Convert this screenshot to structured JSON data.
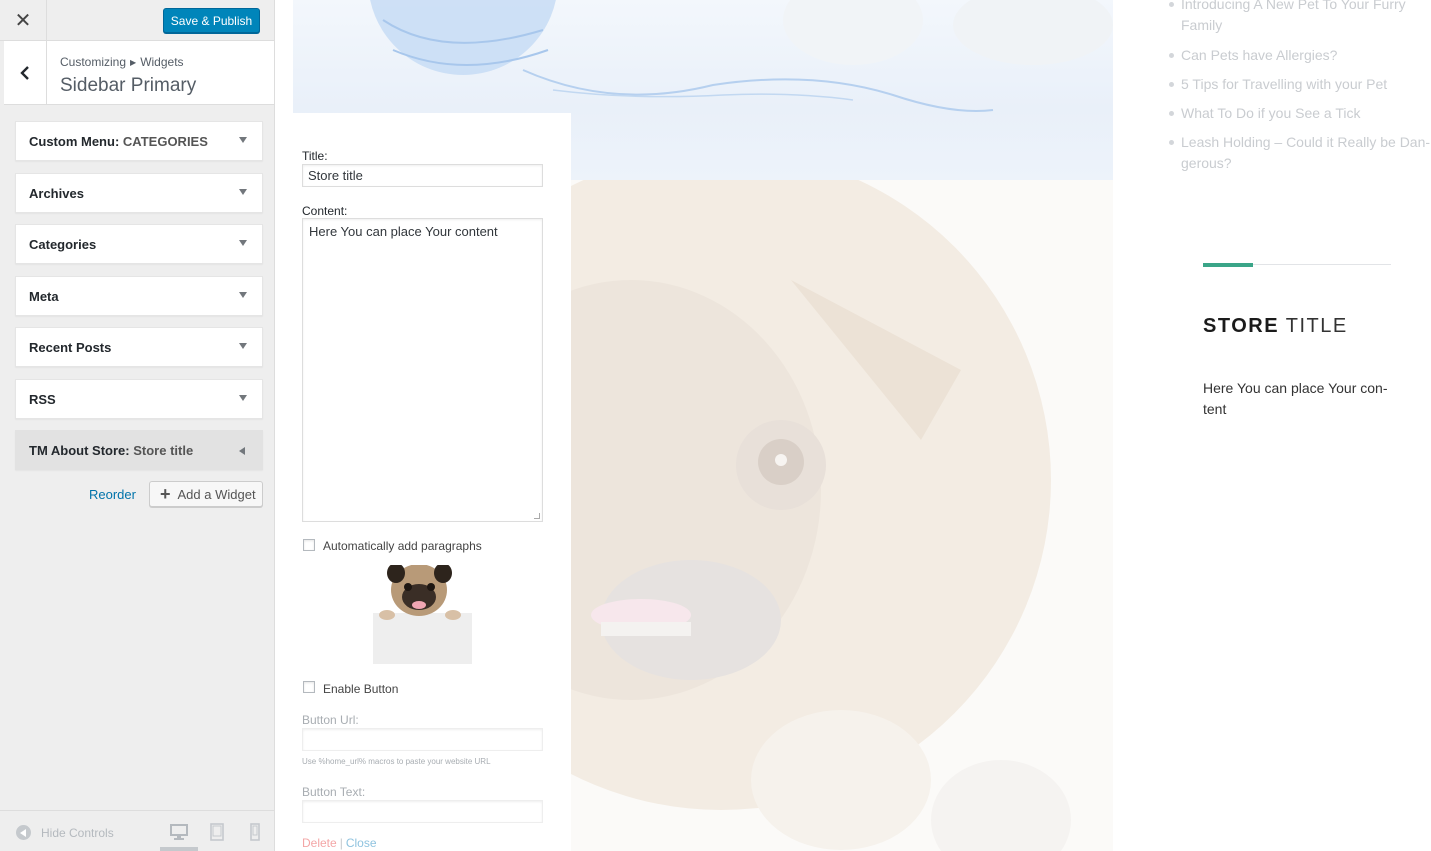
{
  "topbar": {
    "close_icon": "close-icon",
    "save_label": "Save & Publish"
  },
  "section": {
    "breadcrumb_root": "Customizing",
    "breadcrumb_child": "Widgets",
    "title": "Sidebar Primary",
    "back_icon": "chevron-left-icon"
  },
  "widgets": [
    {
      "name": "Custom Menu",
      "instance": "CATEGORIES"
    },
    {
      "name": "Archives",
      "instance": ""
    },
    {
      "name": "Categories",
      "instance": ""
    },
    {
      "name": "Meta",
      "instance": ""
    },
    {
      "name": "Recent Posts",
      "instance": ""
    },
    {
      "name": "RSS",
      "instance": ""
    },
    {
      "name": "TM About Store",
      "instance": "Store title",
      "active": true
    }
  ],
  "widget_actions": {
    "reorder": "Reorder",
    "add_widget": "Add a Widget"
  },
  "footer": {
    "hide_controls": "Hide Controls",
    "devices": [
      "desktop",
      "tablet",
      "mobile"
    ],
    "active_device": "desktop"
  },
  "form": {
    "title_label": "Title:",
    "title_value": "Store title",
    "content_label": "Content:",
    "content_value": "Here You can place Your content",
    "auto_paragraphs_label": "Automatically add paragraphs",
    "auto_paragraphs_checked": false,
    "enable_button_label": "Enable Button",
    "enable_button_checked": false,
    "button_url_label": "Button Url:",
    "button_url_value": "",
    "button_url_hint": "Use %home_url% macros to paste your website URL",
    "button_text_label": "Button Text:",
    "button_text_value": "",
    "delete_link": "Delete",
    "separator": "|",
    "close_link": "Close"
  },
  "preview": {
    "recent_posts": [
      "Introducing A New Pet To Your Furry Family",
      "Can Pets have Allergies?",
      "5 Tips for Travelling with your Pet",
      "What To Do if you See a Tick",
      "Leash Holding – Could it Really be Dan-gerous?"
    ],
    "store_title_bold": "STORE",
    "store_title_light": "TITLE",
    "store_content": "Here You can place Your con-tent",
    "accent_color": "#3aa588"
  },
  "colors": {
    "primary_button": "#0085ba",
    "link": "#0073aa",
    "sidebar_bg": "#eeeeee"
  }
}
